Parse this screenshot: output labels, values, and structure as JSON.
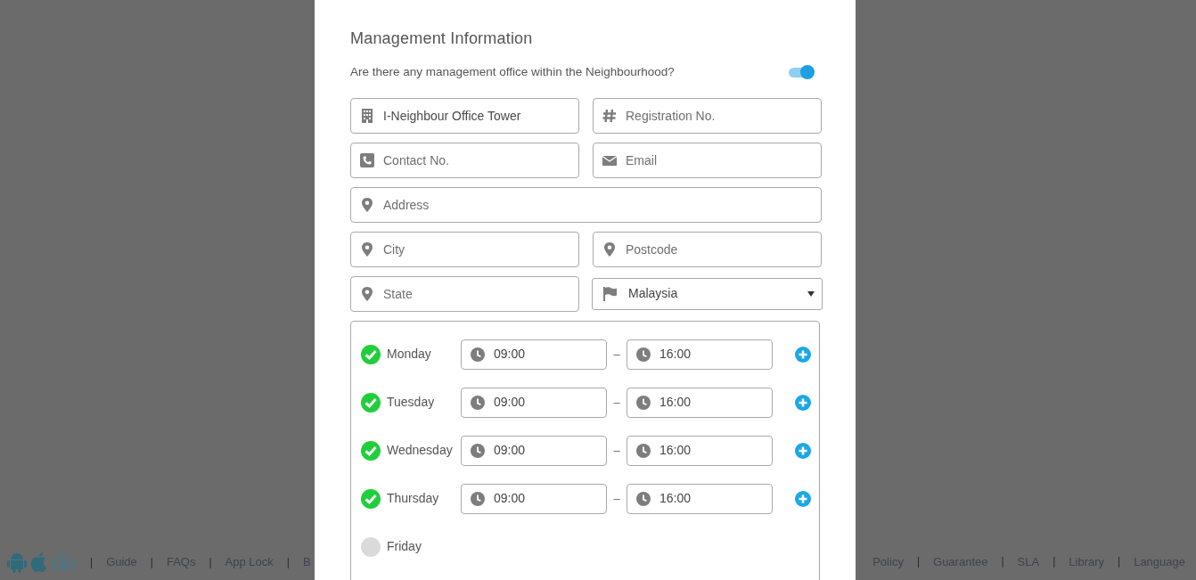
{
  "heading": "Management Information",
  "question": {
    "text": "Are there any management office within the Neighbourhood?",
    "on": true
  },
  "fields": [
    {
      "value": "I-Neighbour Office Tower"
    },
    {
      "placeholder": "Registration No."
    },
    {
      "placeholder": "Contact No."
    },
    {
      "placeholder": "Email"
    },
    {
      "placeholder": "Address"
    },
    {
      "placeholder": "City"
    },
    {
      "placeholder": "Postcode"
    },
    {
      "placeholder": "State"
    }
  ],
  "country": {
    "value": "Malaysia"
  },
  "hours": [
    {
      "day": "Monday",
      "checked": true,
      "open": "09:00",
      "separator": "–",
      "close": "16:00"
    },
    {
      "day": "Tuesday",
      "checked": true,
      "open": "09:00",
      "separator": "–",
      "close": "16:00"
    },
    {
      "day": "Wednesday",
      "checked": true,
      "open": "09:00",
      "separator": "–",
      "close": "16:00"
    },
    {
      "day": "Thursday",
      "checked": true,
      "open": "09:00",
      "separator": "–",
      "close": "16:00"
    },
    {
      "day": "Friday",
      "checked": false
    }
  ],
  "footer": {
    "left": [
      {
        "kind": "separator",
        "text": "|"
      },
      {
        "kind": "link",
        "text": "Guide"
      },
      {
        "kind": "separator",
        "text": "|"
      },
      {
        "kind": "link",
        "text": "FAQs"
      },
      {
        "kind": "separator",
        "text": "|"
      },
      {
        "kind": "link",
        "text": "App Lock"
      },
      {
        "kind": "separator",
        "text": "|"
      },
      {
        "kind": "link",
        "text": "B"
      }
    ],
    "right": [
      {
        "kind": "link",
        "text": "Policy"
      },
      {
        "kind": "separator",
        "text": "|"
      },
      {
        "kind": "link",
        "text": "Guarantee"
      },
      {
        "kind": "separator",
        "text": "|"
      },
      {
        "kind": "link",
        "text": "SLA"
      },
      {
        "kind": "separator",
        "text": "|"
      },
      {
        "kind": "link",
        "text": "Library"
      },
      {
        "kind": "separator",
        "text": "|"
      },
      {
        "kind": "link",
        "text": "Language"
      }
    ]
  }
}
